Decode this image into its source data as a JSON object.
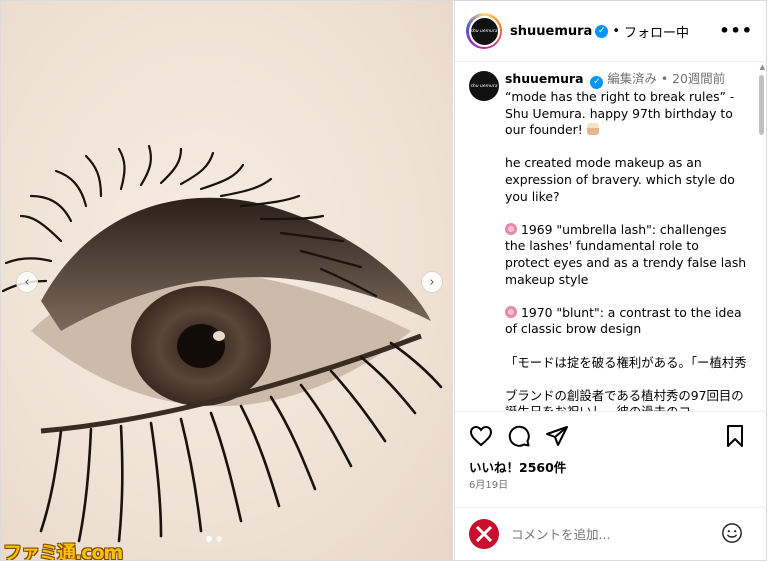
{
  "header": {
    "username": "shuuemura",
    "follow_status": "フォロー中",
    "dot": "•",
    "more": "•••",
    "avatar_text": "shu uemura"
  },
  "caption": {
    "username": "shuuemura",
    "edited": "編集済み",
    "age": "20週間前",
    "paragraphs": [
      "“mode has the right to break rules” - Shu Uemura. happy 97th birthday to our founder!",
      "he created mode makeup as an expression of bravery. which style do you like?",
      "1969 \"umbrella lash\": challenges the lashes' fundamental role to protect eyes and as a trendy false lash makeup style",
      "1970 \"blunt\": a contrast to the idea of classic brow design",
      "「モードは掟を破る権利がある。「ー植村秀",
      "ブランドの創設者である植村秀の97回目の誕生日をお祝いし、彼の過去のコ"
    ]
  },
  "actions": {
    "likes": "いいね！2560件",
    "date": "6月19日"
  },
  "comment": {
    "placeholder": "コメントを追加..."
  },
  "watermark": "ファミ通.com",
  "nav": {
    "prev": "‹",
    "next": "›"
  },
  "icons": [
    "heart-icon",
    "comment-icon",
    "share-icon",
    "bookmark-icon",
    "emoji-icon",
    "verified-icon"
  ]
}
